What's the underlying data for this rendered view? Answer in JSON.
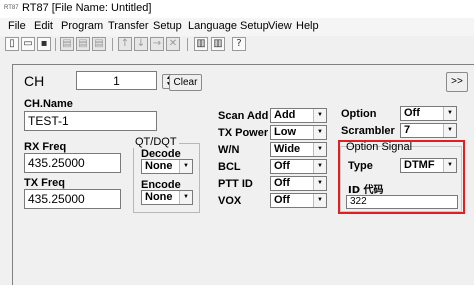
{
  "window": {
    "title": "RT87 [File Name: Untitled]",
    "app_icon_text": "RT87"
  },
  "menu": [
    "File",
    "Edit",
    "Program",
    "Transfer",
    "Setup",
    "Language Setup",
    "View",
    "Help"
  ],
  "toolbar": {
    "icons": [
      "new-icon",
      "open-icon",
      "save-icon",
      "print-icon",
      "print-preview-icon",
      "print-setup-icon",
      "arrow-up-icon",
      "arrow-down-icon",
      "arrow-right-icon",
      "delete-icon",
      "read-radio-icon",
      "write-radio-icon",
      "about-icon"
    ]
  },
  "channel": {
    "ch_label": "CH",
    "ch_value": "1",
    "clear_label": "Clear",
    "next_label": ">>",
    "name_label": "CH.Name",
    "name_value": "TEST-1",
    "rx_label": "RX Freq",
    "rx_value": "435.25000",
    "tx_label": "TX Freq",
    "tx_value": "435.25000"
  },
  "qt": {
    "group_label": "QT/DQT",
    "decode_label": "Decode",
    "decode_value": "None",
    "encode_label": "Encode",
    "encode_value": "None"
  },
  "settings": {
    "scan_add_label": "Scan Add",
    "scan_add_value": "Add",
    "tx_power_label": "TX Power",
    "tx_power_value": "Low",
    "wn_label": "W/N",
    "wn_value": "Wide",
    "bcl_label": "BCL",
    "bcl_value": "Off",
    "ptt_id_label": "PTT ID",
    "ptt_id_value": "Off",
    "vox_label": "VOX",
    "vox_value": "Off",
    "option_label": "Option",
    "option_value": "Off",
    "scrambler_label": "Scrambler",
    "scrambler_value": "7"
  },
  "option_signal": {
    "group_label": "Option Signal",
    "type_label": "Type",
    "type_value": "DTMF",
    "id_label": "ID 代码",
    "id_value": "322"
  },
  "colors": {
    "highlight": "#e02020"
  }
}
